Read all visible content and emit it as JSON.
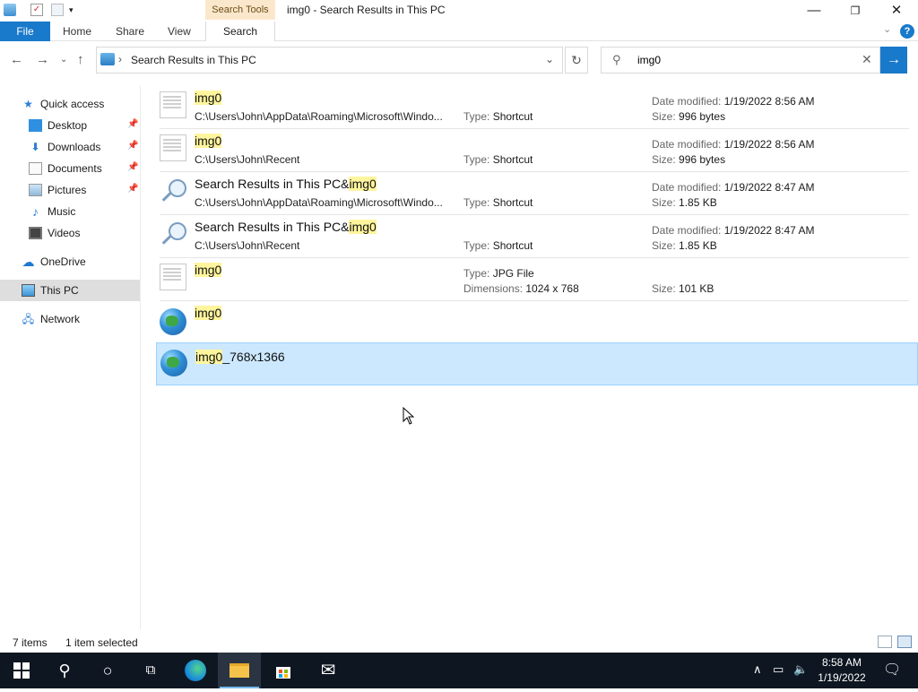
{
  "window": {
    "title": "img0 - Search Results in This PC",
    "context_tab": "Search Tools"
  },
  "ribbon": {
    "tabs": [
      "File",
      "Home",
      "Share",
      "View",
      "Search"
    ]
  },
  "address": {
    "path": "Search Results in This PC"
  },
  "search": {
    "value": "img0"
  },
  "nav": {
    "items": [
      {
        "label": "Quick access",
        "icon": "star-icon"
      },
      {
        "label": "Desktop",
        "icon": "desktop-icon",
        "pinned": true
      },
      {
        "label": "Downloads",
        "icon": "download-icon",
        "pinned": true
      },
      {
        "label": "Documents",
        "icon": "documents-icon",
        "pinned": true
      },
      {
        "label": "Pictures",
        "icon": "pictures-icon",
        "pinned": true
      },
      {
        "label": "Music",
        "icon": "music-icon"
      },
      {
        "label": "Videos",
        "icon": "videos-icon"
      },
      {
        "label": "OneDrive",
        "icon": "cloud-icon"
      },
      {
        "label": "This PC",
        "icon": "computer-icon",
        "selected": true
      },
      {
        "label": "Network",
        "icon": "network-icon"
      }
    ]
  },
  "results": [
    {
      "name_hl": "img0",
      "name_rest": "",
      "name_pre": "",
      "path": "C:\\Users\\John\\AppData\\Roaming\\Microsoft\\Windo...",
      "type_label": "Type:",
      "type": "Shortcut",
      "date_label": "Date modified:",
      "date": "1/19/2022 8:56 AM",
      "size_label": "Size:",
      "size": "996 bytes",
      "icon": "document-icon"
    },
    {
      "name_hl": "img0",
      "name_rest": "",
      "name_pre": "",
      "path": "C:\\Users\\John\\Recent",
      "type_label": "Type:",
      "type": "Shortcut",
      "date_label": "Date modified:",
      "date": "1/19/2022 8:56 AM",
      "size_label": "Size:",
      "size": "996 bytes",
      "icon": "document-icon"
    },
    {
      "name_pre": "Search Results in This PC&",
      "name_hl": "img0",
      "name_rest": "",
      "path": "C:\\Users\\John\\AppData\\Roaming\\Microsoft\\Windo...",
      "type_label": "Type:",
      "type": "Shortcut",
      "date_label": "Date modified:",
      "date": "1/19/2022 8:47 AM",
      "size_label": "Size:",
      "size": "1.85 KB",
      "icon": "search-icon"
    },
    {
      "name_pre": "Search Results in This PC&",
      "name_hl": "img0",
      "name_rest": "",
      "path": "C:\\Users\\John\\Recent",
      "type_label": "Type:",
      "type": "Shortcut",
      "date_label": "Date modified:",
      "date": "1/19/2022 8:47 AM",
      "size_label": "Size:",
      "size": "1.85 KB",
      "icon": "search-icon"
    },
    {
      "name_pre": "",
      "name_hl": "img0",
      "name_rest": "",
      "type_label": "Type:",
      "type": "JPG File",
      "dim_label": "Dimensions:",
      "dimensions": "1024 x 768",
      "size_label": "Size:",
      "size": "101 KB",
      "icon": "document-icon"
    },
    {
      "name_pre": "",
      "name_hl": "img0",
      "name_rest": "",
      "icon": "globe-icon"
    },
    {
      "name_pre": "",
      "name_hl": "img0",
      "name_rest": "_768x1366",
      "icon": "globe-icon",
      "selected": true
    }
  ],
  "status": {
    "count": "7 items",
    "selected": "1 item selected"
  },
  "taskbar": {
    "time": "8:58 AM",
    "date": "1/19/2022"
  }
}
